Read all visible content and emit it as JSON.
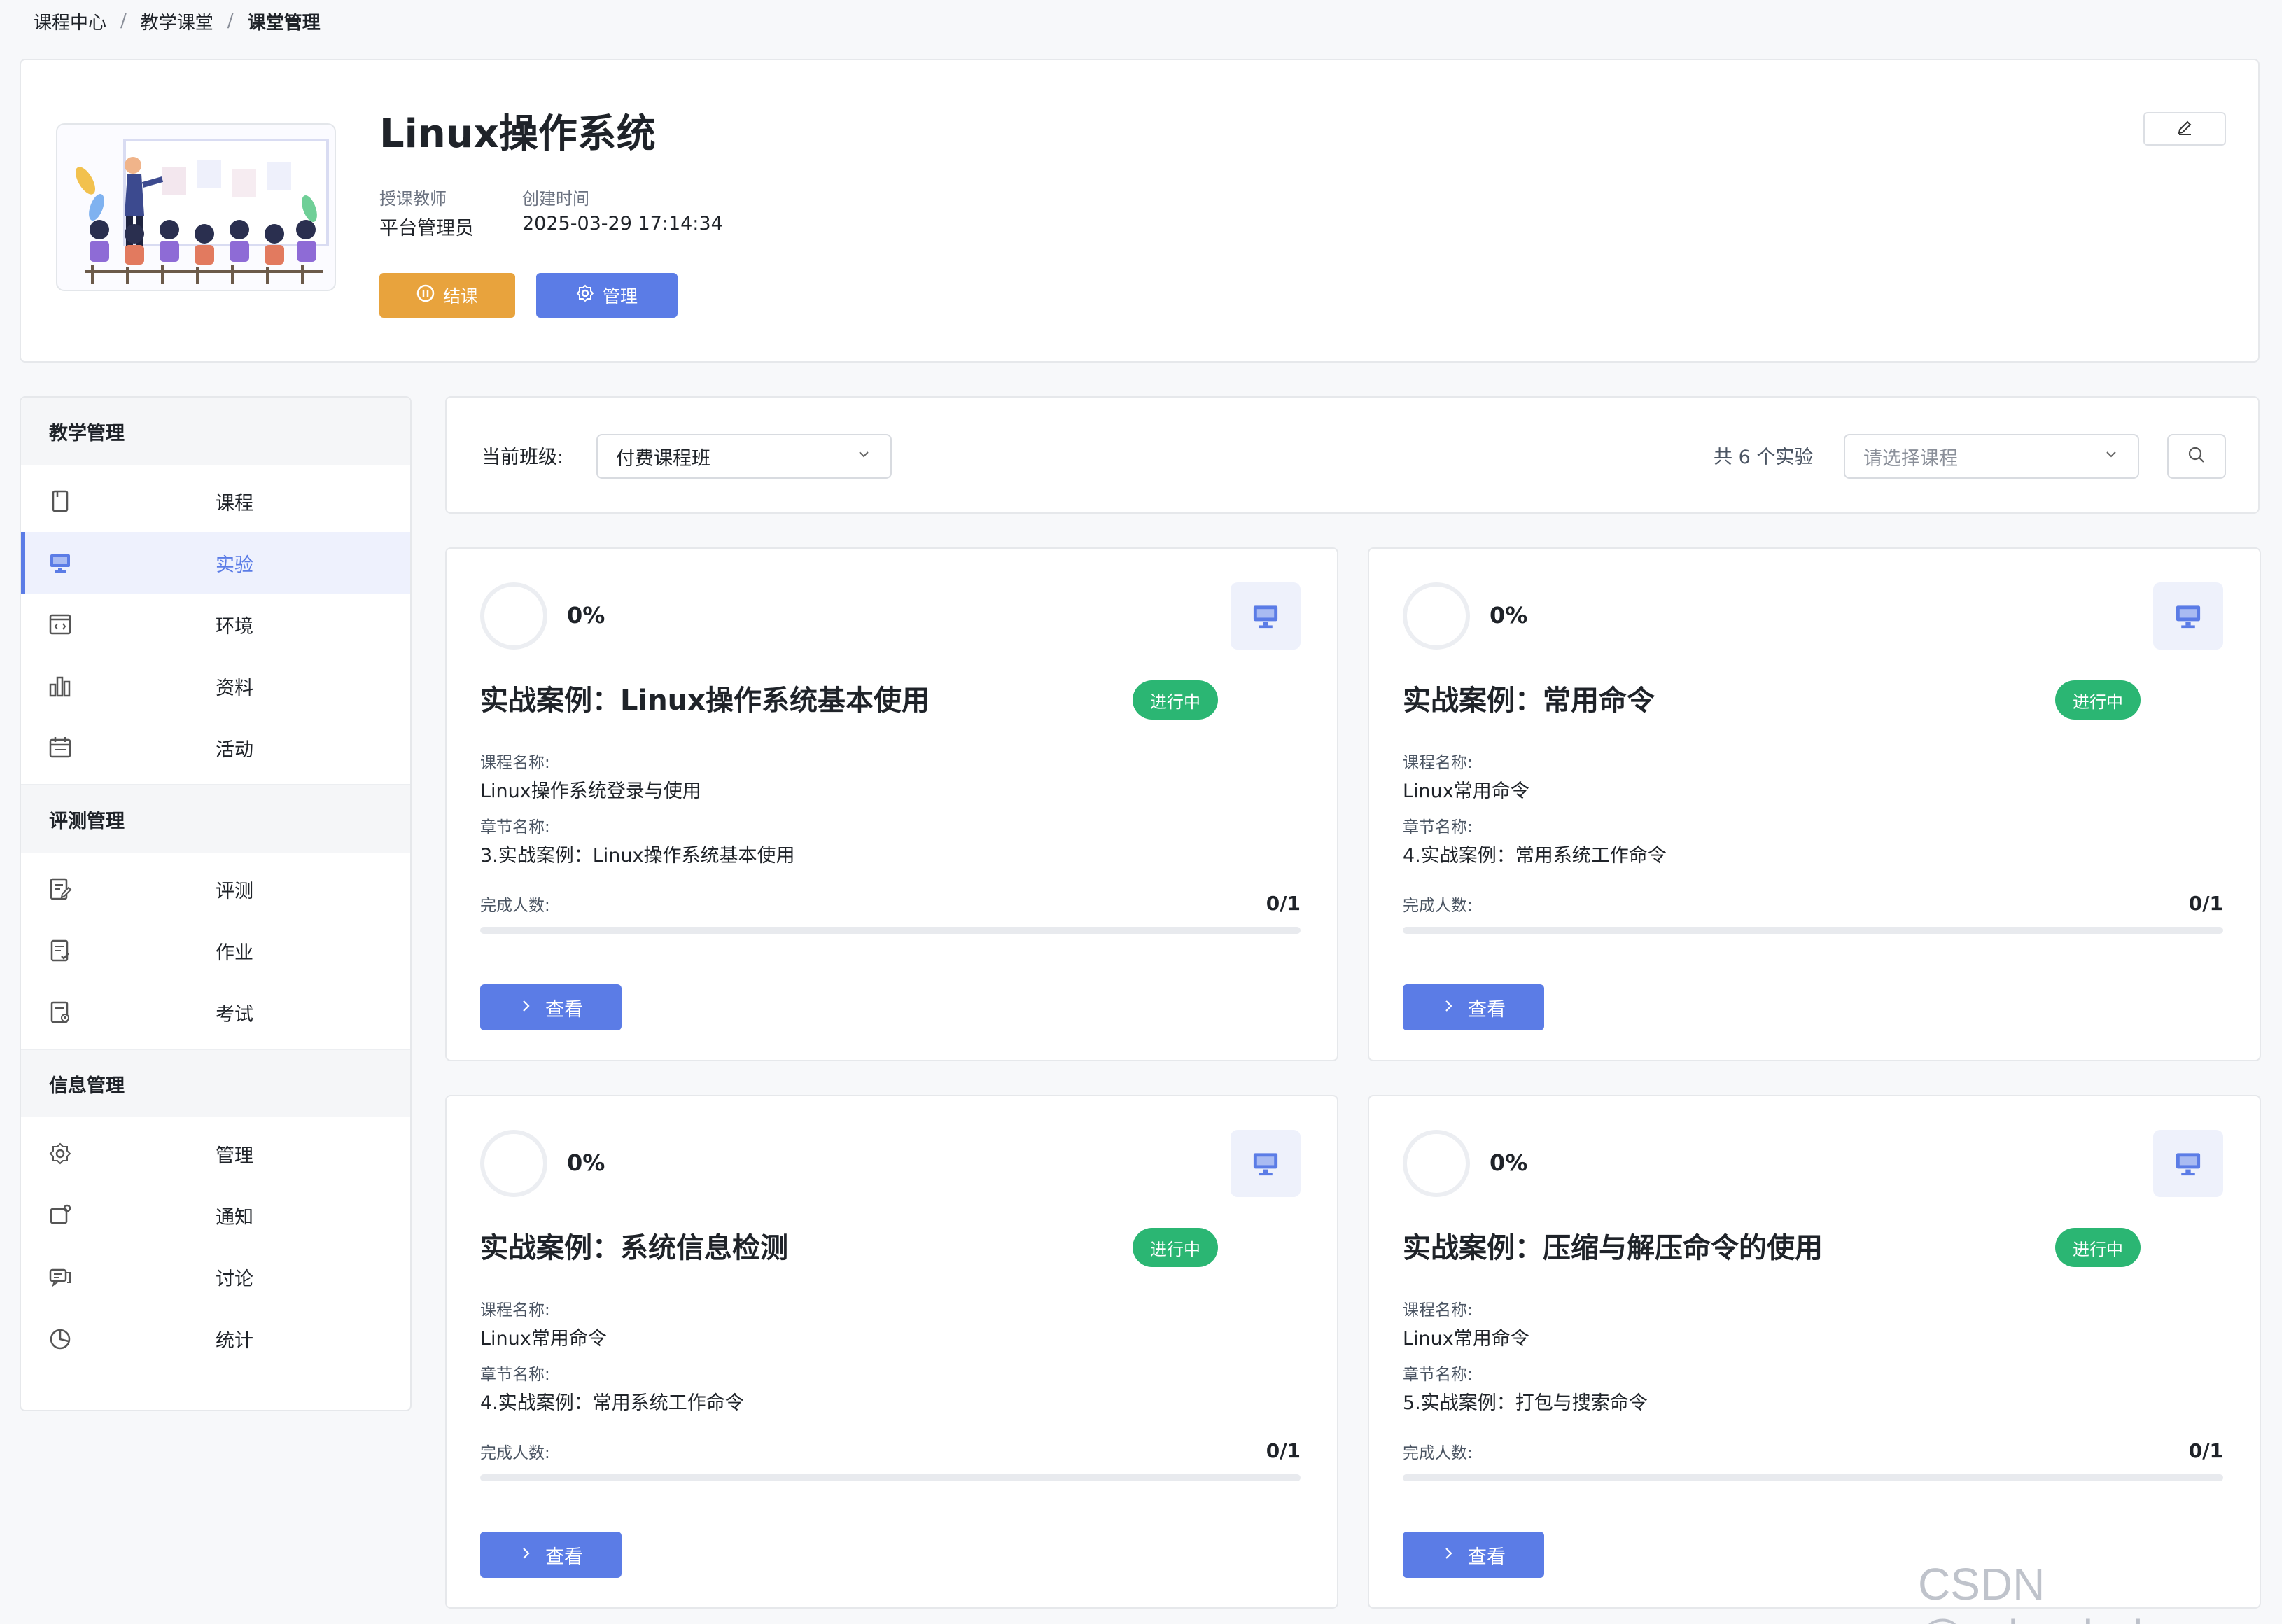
{
  "breadcrumb": [
    "课程中心",
    "教学课堂",
    "课堂管理"
  ],
  "course": {
    "title": "Linux操作系统",
    "teacher_label": "授课教师",
    "teacher": "平台管理员",
    "created_label": "创建时间",
    "created": "2025-03-29 17:14:34",
    "end_button": "结课",
    "manage_button": "管理"
  },
  "sidebar": {
    "sections": [
      {
        "title": "教学管理",
        "items": [
          {
            "label": "课程",
            "icon": "book-icon",
            "active": false
          },
          {
            "label": "实验",
            "icon": "monitor-icon",
            "active": true
          },
          {
            "label": "环境",
            "icon": "code-window-icon",
            "active": false
          },
          {
            "label": "资料",
            "icon": "bar-chart-icon",
            "active": false
          },
          {
            "label": "活动",
            "icon": "calendar-icon",
            "active": false
          }
        ]
      },
      {
        "title": "评测管理",
        "items": [
          {
            "label": "评测",
            "icon": "edit-doc-icon",
            "active": false
          },
          {
            "label": "作业",
            "icon": "checked-doc-icon",
            "active": false
          },
          {
            "label": "考试",
            "icon": "exam-doc-icon",
            "active": false
          }
        ]
      },
      {
        "title": "信息管理",
        "items": [
          {
            "label": "管理",
            "icon": "gear-icon",
            "active": false
          },
          {
            "label": "通知",
            "icon": "notice-icon",
            "active": false
          },
          {
            "label": "讨论",
            "icon": "chat-icon",
            "active": false
          },
          {
            "label": "统计",
            "icon": "pie-icon",
            "active": false
          }
        ]
      }
    ]
  },
  "filter": {
    "class_label": "当前班级:",
    "class_value": "付费课程班",
    "count_text": "共 6 个实验",
    "course_placeholder": "请选择课程"
  },
  "labels": {
    "course_name": "课程名称:",
    "chapter_name": "章节名称:",
    "done_count": "完成人数:",
    "view": "查看"
  },
  "experiments": [
    {
      "progress": "0%",
      "title": "实战案例：Linux操作系统基本使用",
      "status": "进行中",
      "course": "Linux操作系统登录与使用",
      "chapter": "3.实战案例：Linux操作系统基本使用",
      "done": "0/1",
      "done_fraction": 0
    },
    {
      "progress": "0%",
      "title": "实战案例：常用命令",
      "status": "进行中",
      "course": "Linux常用命令",
      "chapter": "4.实战案例：常用系统工作命令",
      "done": "0/1",
      "done_fraction": 0
    },
    {
      "progress": "0%",
      "title": "实战案例：系统信息检测",
      "status": "进行中",
      "course": "Linux常用命令",
      "chapter": "4.实战案例：常用系统工作命令",
      "done": "0/1",
      "done_fraction": 0
    },
    {
      "progress": "0%",
      "title": "实战案例：压缩与解压命令的使用",
      "status": "进行中",
      "course": "Linux常用命令",
      "chapter": "5.实战案例：打包与搜索命令",
      "done": "0/1",
      "done_fraction": 0
    }
  ],
  "watermark": "CSDN @zcloudedu",
  "colors": {
    "primary": "#5b7ce6",
    "warning": "#e8a33d",
    "success": "#2bb673"
  }
}
